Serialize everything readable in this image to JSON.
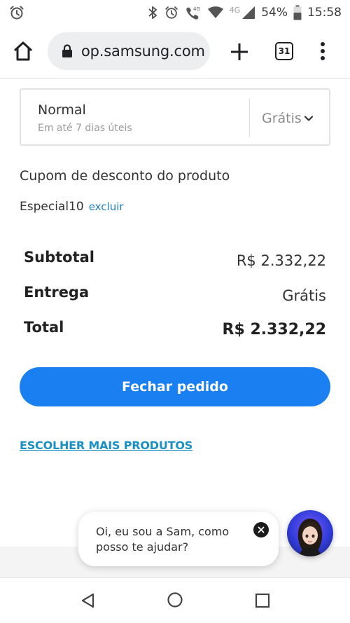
{
  "status_bar": {
    "network": "4G",
    "battery": "54%",
    "time": "15:58"
  },
  "browser": {
    "url": "op.samsung.com",
    "tab_count": "31"
  },
  "shipping": {
    "method": "Normal",
    "description": "Em até 7 dias úteis",
    "price": "Grátis"
  },
  "coupon": {
    "title": "Cupom de desconto do produto",
    "code": "Especial10",
    "remove_label": "excluir"
  },
  "summary": {
    "subtotal_label": "Subtotal",
    "subtotal_value": "R$ 2.332,22",
    "delivery_label": "Entrega",
    "delivery_value": "Grátis",
    "total_label": "Total",
    "total_value": "R$ 2.332,22"
  },
  "checkout_button": "Fechar pedido",
  "more_products_link": "ESCOLHER MAIS PRODUTOS",
  "chat": {
    "message": "Oi, eu sou a Sam, como posso te ajudar?"
  },
  "colors": {
    "primary": "#1a7ff0",
    "link": "#1a90c4"
  }
}
